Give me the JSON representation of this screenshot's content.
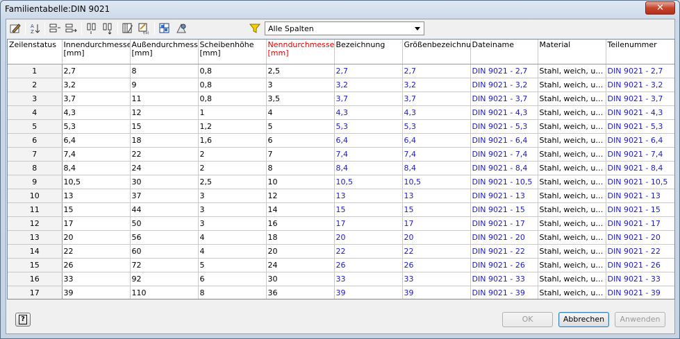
{
  "window": {
    "title": "Familientabelle:DIN 9021",
    "close_label": "✕"
  },
  "toolbar": {
    "filter_label": "Alle Spalten"
  },
  "table": {
    "headers": [
      {
        "label": "Zeilenstatus",
        "unit": ""
      },
      {
        "label": "Innendurchmesser",
        "unit": "[mm]"
      },
      {
        "label": "Außendurchmesser",
        "unit": "[mm]"
      },
      {
        "label": "Scheibenhöhe",
        "unit": "[mm]"
      },
      {
        "label": "Nenndurchmesser",
        "unit": "[mm]"
      },
      {
        "label": "Bezeichnung",
        "unit": ""
      },
      {
        "label": "Größenbezeichnung",
        "unit": ""
      },
      {
        "label": "Dateiname",
        "unit": ""
      },
      {
        "label": "Material",
        "unit": ""
      },
      {
        "label": "Teilenummer",
        "unit": ""
      }
    ],
    "rows": [
      [
        "1",
        "2,7",
        "8",
        "0,8",
        "2,5",
        "2,7",
        "2,7",
        "DIN 9021 - 2,7",
        "Stahl, weich, unle...",
        "DIN 9021 - 2,7"
      ],
      [
        "2",
        "3,2",
        "9",
        "0,8",
        "3",
        "3,2",
        "3,2",
        "DIN 9021 - 3,2",
        "Stahl, weich, unle...",
        "DIN 9021 - 3,2"
      ],
      [
        "3",
        "3,7",
        "11",
        "0,8",
        "3,5",
        "3,7",
        "3,7",
        "DIN 9021 - 3,7",
        "Stahl, weich, unle...",
        "DIN 9021 - 3,7"
      ],
      [
        "4",
        "4,3",
        "12",
        "1",
        "4",
        "4,3",
        "4,3",
        "DIN 9021 - 4,3",
        "Stahl, weich, unle...",
        "DIN 9021 - 4,3"
      ],
      [
        "5",
        "5,3",
        "15",
        "1,2",
        "5",
        "5,3",
        "5,3",
        "DIN 9021 - 5,3",
        "Stahl, weich, unle...",
        "DIN 9021 - 5,3"
      ],
      [
        "6",
        "6,4",
        "18",
        "1,6",
        "6",
        "6,4",
        "6,4",
        "DIN 9021 - 6,4",
        "Stahl, weich, unle...",
        "DIN 9021 - 6,4"
      ],
      [
        "7",
        "7,4",
        "22",
        "2",
        "7",
        "7,4",
        "7,4",
        "DIN 9021 - 7,4",
        "Stahl, weich, unle...",
        "DIN 9021 - 7,4"
      ],
      [
        "8",
        "8,4",
        "24",
        "2",
        "8",
        "8,4",
        "8,4",
        "DIN 9021 - 8,4",
        "Stahl, weich, unle...",
        "DIN 9021 - 8,4"
      ],
      [
        "9",
        "10,5",
        "30",
        "2,5",
        "10",
        "10,5",
        "10,5",
        "DIN 9021 - 10,5",
        "Stahl, weich, unle...",
        "DIN 9021 - 10,5"
      ],
      [
        "10",
        "13",
        "37",
        "3",
        "12",
        "13",
        "13",
        "DIN 9021 - 13",
        "Stahl, weich, unle...",
        "DIN 9021 - 13"
      ],
      [
        "11",
        "15",
        "44",
        "3",
        "14",
        "15",
        "15",
        "DIN 9021 - 15",
        "Stahl, weich, unle...",
        "DIN 9021 - 15"
      ],
      [
        "12",
        "17",
        "50",
        "3",
        "16",
        "17",
        "17",
        "DIN 9021 - 17",
        "Stahl, weich, unle...",
        "DIN 9021 - 17"
      ],
      [
        "13",
        "20",
        "56",
        "4",
        "18",
        "20",
        "20",
        "DIN 9021 - 20",
        "Stahl, weich, unle...",
        "DIN 9021 - 20"
      ],
      [
        "14",
        "22",
        "60",
        "4",
        "20",
        "22",
        "22",
        "DIN 9021 - 22",
        "Stahl, weich, unle...",
        "DIN 9021 - 22"
      ],
      [
        "15",
        "26",
        "72",
        "5",
        "24",
        "26",
        "26",
        "DIN 9021 - 26",
        "Stahl, weich, unle...",
        "DIN 9021 - 26"
      ],
      [
        "16",
        "33",
        "92",
        "6",
        "30",
        "33",
        "33",
        "DIN 9021 - 33",
        "Stahl, weich, unle...",
        "DIN 9021 - 33"
      ],
      [
        "17",
        "39",
        "110",
        "8",
        "36",
        "39",
        "39",
        "DIN 9021 - 39",
        "Stahl, weich, unle...",
        "DIN 9021 - 39"
      ]
    ]
  },
  "buttons": {
    "help_label": "?",
    "ok_label": "OK",
    "cancel_label": "Abbrechen",
    "apply_label": "Anwenden"
  },
  "colors": {
    "key_column_header": "#e00000",
    "computed_value": "#1a1ad0"
  }
}
